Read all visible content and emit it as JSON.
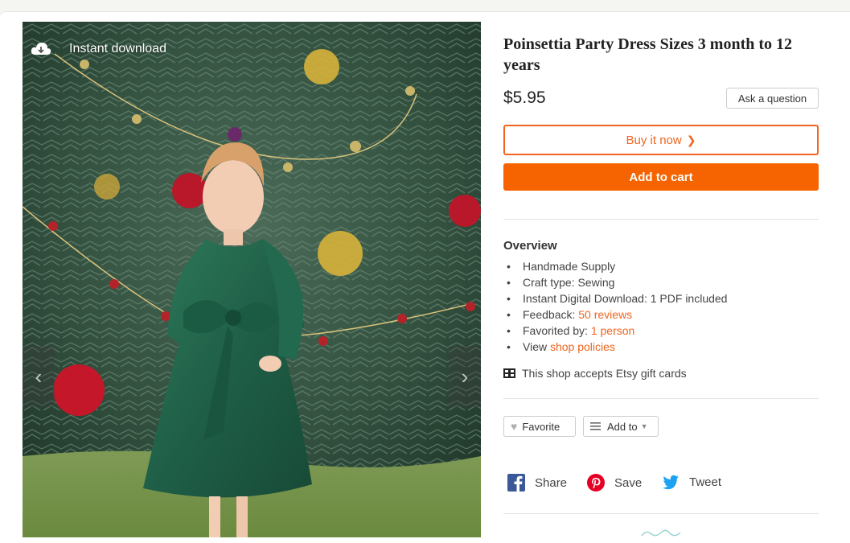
{
  "photo": {
    "badge_label": "Instant download",
    "prev_glyph": "‹",
    "next_glyph": "›"
  },
  "listing": {
    "title": "Poinsettia Party Dress Sizes 3 month to 12 years",
    "price": "$5.95",
    "ask_label": "Ask a question",
    "buy_now_label": "Buy it now",
    "add_to_cart_label": "Add to cart"
  },
  "overview": {
    "heading": "Overview",
    "item1": "Handmade Supply",
    "item2": "Craft type: Sewing",
    "item3": "Instant Digital Download: 1 PDF included",
    "item4_prefix": "Feedback: ",
    "item4_link": "50 reviews",
    "item5_prefix": "Favorited by: ",
    "item5_link": "1 person",
    "item6_prefix": "View ",
    "item6_link": "shop policies"
  },
  "gift": {
    "label": "This shop accepts Etsy gift cards"
  },
  "actions": {
    "favorite_label": "Favorite",
    "add_to_label": "Add to"
  },
  "share": {
    "facebook": "Share",
    "pinterest": "Save",
    "twitter": "Tweet"
  },
  "colors": {
    "accent": "#f1641e",
    "cart": "#f56400",
    "facebook": "#3b5998",
    "pinterest": "#e60023",
    "twitter": "#1da1f2"
  },
  "icons": {
    "download": "cloud-download-icon",
    "gift": "gift-card-icon",
    "favorite": "heart-icon",
    "add_to": "list-icon",
    "facebook": "facebook-icon",
    "pinterest": "pinterest-icon",
    "twitter": "twitter-icon"
  }
}
